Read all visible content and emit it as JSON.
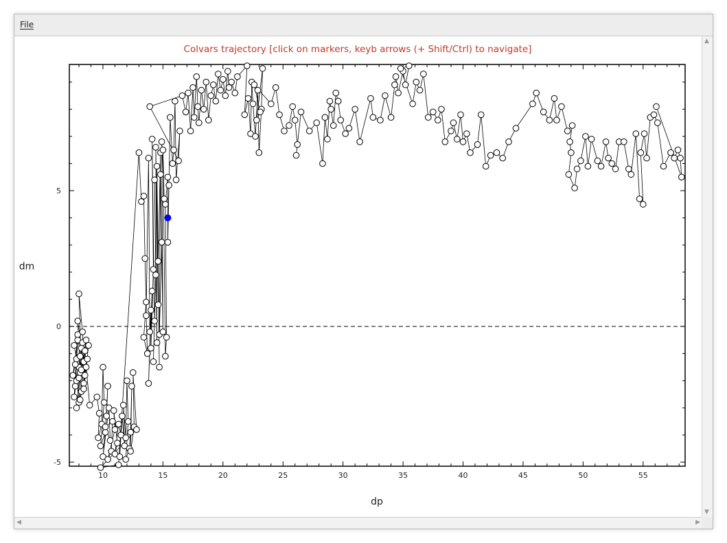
{
  "menu": {
    "file_label": "File"
  },
  "chart_data": {
    "type": "scatter",
    "title": "Colvars trajectory   [click on markers, keyb arrows (+ Shift/Ctrl) to navigate]",
    "xlabel": "dp",
    "ylabel": "dm",
    "xlim": [
      7.2,
      58.5
    ],
    "ylim": [
      -5.15,
      9.65
    ],
    "xticks": [
      10,
      15,
      20,
      25,
      30,
      35,
      40,
      45,
      50,
      55
    ],
    "yticks": [
      -5,
      0,
      5
    ],
    "reference_line_y": 0,
    "connected": true,
    "colors": {
      "marker_fill": "#ffffff",
      "marker_stroke": "#000000",
      "selected": "#0000ff",
      "title": "#c0392b",
      "line": "#000000"
    },
    "selected_point": {
      "x": 15.4,
      "y": 4.0
    },
    "points": [
      [
        7.6,
        -0.7
      ],
      [
        7.8,
        -1.2
      ],
      [
        7.5,
        -1.8
      ],
      [
        7.9,
        -0.5
      ],
      [
        7.7,
        -2.2
      ],
      [
        8.0,
        -1.5
      ],
      [
        7.6,
        -2.6
      ],
      [
        7.9,
        -0.3
      ],
      [
        8.1,
        -1.1
      ],
      [
        7.8,
        -2.0
      ],
      [
        8.2,
        -0.8
      ],
      [
        8.0,
        -2.8
      ],
      [
        7.7,
        -1.4
      ],
      [
        8.3,
        -0.6
      ],
      [
        8.0,
        -1.9
      ],
      [
        8.4,
        -1.3
      ],
      [
        7.9,
        0.2
      ],
      [
        8.2,
        -2.4
      ],
      [
        8.5,
        -0.9
      ],
      [
        8.1,
        -1.7
      ],
      [
        7.8,
        -3.0
      ],
      [
        8.4,
        -2.1
      ],
      [
        8.6,
        -0.5
      ],
      [
        8.2,
        -1.6
      ],
      [
        8.0,
        1.2
      ],
      [
        8.3,
        -0.2
      ],
      [
        8.5,
        -1.8
      ],
      [
        8.1,
        -2.7
      ],
      [
        8.7,
        -1.2
      ],
      [
        8.4,
        -2.3
      ],
      [
        8.8,
        -0.7
      ],
      [
        8.6,
        -1.5
      ],
      [
        8.9,
        -2.9
      ],
      [
        9.5,
        -2.6
      ],
      [
        9.7,
        -3.2
      ],
      [
        9.6,
        -4.1
      ],
      [
        9.9,
        -3.6
      ],
      [
        10.0,
        -1.5
      ],
      [
        10.1,
        -2.8
      ],
      [
        9.8,
        -4.4
      ],
      [
        10.2,
        -3.9
      ],
      [
        10.4,
        -2.2
      ],
      [
        10.3,
        -3.3
      ],
      [
        10.0,
        -4.8
      ],
      [
        10.5,
        -3.0
      ],
      [
        10.6,
        -4.2
      ],
      [
        10.2,
        -3.7
      ],
      [
        10.8,
        -3.5
      ],
      [
        10.7,
        -4.6
      ],
      [
        10.4,
        -4.9
      ],
      [
        11.0,
        -3.8
      ],
      [
        10.9,
        -3.1
      ],
      [
        11.2,
        -4.3
      ],
      [
        11.0,
        -4.7
      ],
      [
        11.3,
        -3.6
      ],
      [
        11.5,
        -4.0
      ],
      [
        11.4,
        -4.8
      ],
      [
        11.6,
        -3.3
      ],
      [
        11.8,
        -4.4
      ],
      [
        11.7,
        -2.9
      ],
      [
        11.9,
        -4.1
      ],
      [
        12.0,
        -2.0
      ],
      [
        12.1,
        -3.5
      ],
      [
        11.9,
        -4.9
      ],
      [
        12.2,
        -4.5
      ],
      [
        12.3,
        -3.9
      ],
      [
        12.4,
        -2.2
      ],
      [
        12.3,
        -4.6
      ],
      [
        12.6,
        -3.7
      ],
      [
        12.5,
        -1.7
      ],
      [
        12.8,
        -3.8
      ],
      [
        9.8,
        -5.2
      ],
      [
        11.3,
        -5.1
      ],
      [
        13.0,
        6.4
      ],
      [
        13.2,
        4.6
      ],
      [
        13.4,
        4.8
      ],
      [
        13.5,
        2.5
      ],
      [
        13.6,
        0.9
      ],
      [
        13.4,
        -0.4
      ],
      [
        13.7,
        -1.0
      ],
      [
        13.6,
        0.4
      ],
      [
        13.8,
        6.2
      ],
      [
        13.9,
        -0.2
      ],
      [
        14.0,
        0.6
      ],
      [
        13.8,
        -2.1
      ],
      [
        14.1,
        1.3
      ],
      [
        14.0,
        -0.8
      ],
      [
        14.2,
        2.1
      ],
      [
        14.1,
        6.9
      ],
      [
        14.3,
        0.2
      ],
      [
        14.2,
        -1.3
      ],
      [
        14.4,
        1.9
      ],
      [
        14.3,
        5.4
      ],
      [
        14.5,
        -0.6
      ],
      [
        14.4,
        6.6
      ],
      [
        14.6,
        0.8
      ],
      [
        14.5,
        5.9
      ],
      [
        14.7,
        -1.5
      ],
      [
        14.6,
        2.4
      ],
      [
        14.8,
        6.4
      ],
      [
        14.7,
        -0.3
      ],
      [
        14.9,
        3.1
      ],
      [
        14.8,
        5.6
      ],
      [
        15.0,
        -0.2
      ],
      [
        14.9,
        6.8
      ],
      [
        15.1,
        4.7
      ],
      [
        15.0,
        6.5
      ],
      [
        15.2,
        -1.1
      ],
      [
        15.3,
        -0.4
      ],
      [
        15.2,
        4.5
      ],
      [
        15.4,
        5.5
      ],
      [
        15.4,
        3.1
      ],
      [
        15.5,
        5.2
      ],
      [
        15.6,
        7.7
      ],
      [
        15.8,
        6.0
      ],
      [
        15.9,
        6.5
      ],
      [
        16.0,
        8.3
      ],
      [
        16.1,
        5.4
      ],
      [
        16.4,
        7.2
      ],
      [
        16.3,
        6.1
      ],
      [
        13.9,
        8.1
      ],
      [
        16.6,
        8.5
      ],
      [
        16.9,
        7.9
      ],
      [
        17.1,
        8.6
      ],
      [
        17.3,
        7.2
      ],
      [
        17.5,
        8.8
      ],
      [
        17.6,
        7.7
      ],
      [
        17.8,
        9.2
      ],
      [
        17.9,
        8.1
      ],
      [
        18.0,
        7.5
      ],
      [
        18.2,
        8.7
      ],
      [
        18.4,
        8.0
      ],
      [
        18.6,
        9.0
      ],
      [
        18.8,
        7.6
      ],
      [
        19.0,
        8.5
      ],
      [
        19.2,
        8.9
      ],
      [
        19.4,
        8.3
      ],
      [
        19.6,
        9.3
      ],
      [
        19.8,
        8.7
      ],
      [
        20.0,
        9.1
      ],
      [
        20.2,
        8.5
      ],
      [
        20.4,
        9.4
      ],
      [
        20.5,
        8.8
      ],
      [
        20.7,
        9.0
      ],
      [
        21.0,
        8.6
      ],
      [
        21.2,
        9.2
      ],
      [
        22.0,
        9.6
      ],
      [
        21.8,
        7.8
      ],
      [
        22.1,
        8.4
      ],
      [
        22.3,
        7.1
      ],
      [
        22.4,
        9.0
      ],
      [
        22.5,
        8.2
      ],
      [
        22.7,
        7.0
      ],
      [
        22.9,
        8.7
      ],
      [
        23.0,
        6.4
      ],
      [
        23.2,
        8.0
      ],
      [
        23.3,
        9.5
      ],
      [
        22.8,
        7.6
      ],
      [
        23.1,
        7.9
      ],
      [
        22.6,
        8.9
      ],
      [
        24.0,
        8.2
      ],
      [
        24.4,
        8.8
      ],
      [
        24.7,
        7.8
      ],
      [
        25.1,
        7.2
      ],
      [
        25.5,
        7.4
      ],
      [
        25.8,
        8.1
      ],
      [
        26.0,
        7.6
      ],
      [
        26.2,
        6.7
      ],
      [
        26.1,
        6.3
      ],
      [
        26.5,
        7.9
      ],
      [
        27.2,
        7.2
      ],
      [
        27.8,
        7.5
      ],
      [
        28.3,
        6.0
      ],
      [
        28.5,
        7.7
      ],
      [
        28.7,
        6.9
      ],
      [
        28.9,
        8.3
      ],
      [
        29.0,
        8.0
      ],
      [
        29.2,
        7.4
      ],
      [
        29.4,
        8.6
      ],
      [
        29.6,
        8.3
      ],
      [
        29.8,
        7.6
      ],
      [
        30.2,
        7.1
      ],
      [
        30.5,
        7.3
      ],
      [
        31.0,
        8.0
      ],
      [
        31.4,
        6.8
      ],
      [
        32.3,
        8.4
      ],
      [
        32.5,
        7.7
      ],
      [
        33.1,
        7.6
      ],
      [
        33.5,
        8.5
      ],
      [
        34.0,
        7.7
      ],
      [
        34.3,
        8.9
      ],
      [
        34.4,
        9.2
      ],
      [
        34.6,
        8.6
      ],
      [
        35.0,
        9.4
      ],
      [
        35.2,
        8.9
      ],
      [
        35.5,
        9.6
      ],
      [
        34.8,
        9.5
      ],
      [
        35.8,
        8.2
      ],
      [
        36.1,
        9.0
      ],
      [
        36.4,
        8.7
      ],
      [
        36.7,
        9.3
      ],
      [
        37.1,
        7.7
      ],
      [
        37.5,
        7.9
      ],
      [
        37.9,
        7.6
      ],
      [
        38.2,
        8.0
      ],
      [
        38.5,
        6.8
      ],
      [
        39.0,
        7.2
      ],
      [
        39.2,
        7.5
      ],
      [
        39.5,
        6.9
      ],
      [
        39.8,
        7.8
      ],
      [
        40.0,
        6.8
      ],
      [
        40.3,
        7.1
      ],
      [
        40.6,
        6.4
      ],
      [
        41.2,
        6.7
      ],
      [
        41.5,
        7.8
      ],
      [
        41.9,
        5.9
      ],
      [
        42.3,
        6.3
      ],
      [
        42.8,
        6.4
      ],
      [
        43.3,
        6.2
      ],
      [
        43.8,
        6.8
      ],
      [
        44.4,
        7.3
      ],
      [
        45.8,
        8.2
      ],
      [
        46.1,
        8.6
      ],
      [
        46.7,
        7.9
      ],
      [
        47.2,
        7.6
      ],
      [
        47.6,
        8.4
      ],
      [
        47.8,
        7.6
      ],
      [
        48.2,
        8.1
      ],
      [
        48.7,
        7.2
      ],
      [
        49.1,
        7.4
      ],
      [
        48.9,
        6.8
      ],
      [
        49.0,
        6.4
      ],
      [
        48.8,
        5.6
      ],
      [
        49.3,
        5.1
      ],
      [
        49.5,
        5.8
      ],
      [
        49.8,
        6.1
      ],
      [
        50.2,
        7.0
      ],
      [
        50.4,
        5.9
      ],
      [
        50.7,
        6.9
      ],
      [
        51.2,
        6.1
      ],
      [
        51.5,
        5.9
      ],
      [
        51.9,
        6.8
      ],
      [
        52.1,
        6.2
      ],
      [
        52.4,
        6.0
      ],
      [
        52.7,
        5.8
      ],
      [
        53.0,
        6.8
      ],
      [
        53.4,
        6.8
      ],
      [
        53.8,
        5.8
      ],
      [
        54.0,
        5.6
      ],
      [
        54.4,
        7.1
      ],
      [
        54.7,
        4.7
      ],
      [
        55.0,
        4.5
      ],
      [
        54.8,
        6.4
      ],
      [
        55.1,
        7.1
      ],
      [
        55.3,
        6.2
      ],
      [
        55.6,
        7.7
      ],
      [
        55.9,
        7.8
      ],
      [
        56.2,
        7.5
      ],
      [
        56.7,
        5.9
      ],
      [
        57.3,
        6.4
      ],
      [
        57.6,
        6.2
      ],
      [
        57.9,
        6.5
      ],
      [
        58.1,
        6.2
      ],
      [
        58.2,
        5.5
      ],
      [
        56.1,
        8.1
      ]
    ]
  }
}
